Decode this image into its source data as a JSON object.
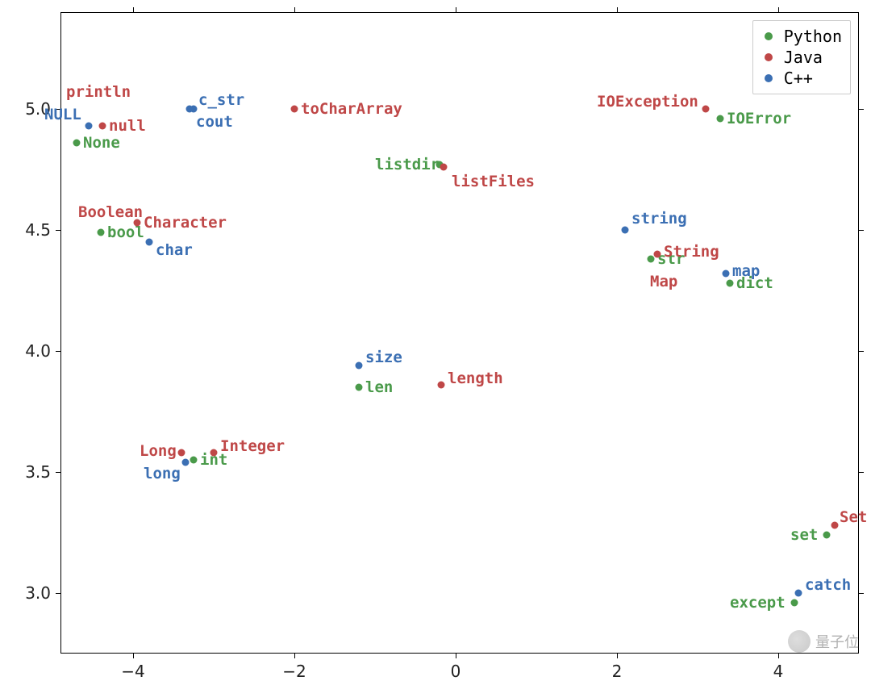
{
  "chart_data": {
    "type": "scatter",
    "xlim": [
      -4.9,
      5.0
    ],
    "ylim": [
      2.75,
      5.4
    ],
    "xticks": [
      -4,
      -2,
      0,
      2,
      4
    ],
    "yticks": [
      3.0,
      3.5,
      4.0,
      4.5,
      5.0
    ],
    "colors": {
      "Python": "#4a9a4a",
      "Java": "#bf4747",
      "C++": "#3b6fb3"
    },
    "legend": {
      "position": "upper-right",
      "entries": [
        {
          "series": "Python",
          "label": "Python"
        },
        {
          "series": "Java",
          "label": "Java"
        },
        {
          "series": "C++",
          "label": "C++"
        }
      ]
    },
    "series": [
      {
        "name": "Python",
        "points": [
          {
            "x": -4.7,
            "y": 4.86,
            "label": "None",
            "dx": 8,
            "dy": 0
          },
          {
            "x": -4.4,
            "y": 4.49,
            "label": "bool",
            "dx": 8,
            "dy": 0
          },
          {
            "x": -0.2,
            "y": 4.77,
            "label": "listdir",
            "dx": -80,
            "dy": 0,
            "anchor": "right"
          },
          {
            "x": 2.42,
            "y": 4.38,
            "label": "str",
            "dx": 8,
            "dy": 0
          },
          {
            "x": 3.4,
            "y": 4.28,
            "label": "dict",
            "dx": 8,
            "dy": 0
          },
          {
            "x": -1.2,
            "y": 3.85,
            "label": "len",
            "dx": 8,
            "dy": 0
          },
          {
            "x": -3.25,
            "y": 3.55,
            "label": "int",
            "dx": 8,
            "dy": 0
          },
          {
            "x": 4.6,
            "y": 3.24,
            "label": "set",
            "dx": -45,
            "dy": 0,
            "anchor": "right"
          },
          {
            "x": 4.2,
            "y": 2.96,
            "label": "except",
            "dx": -80,
            "dy": 0,
            "anchor": "right"
          },
          {
            "x": 3.28,
            "y": 4.96,
            "label": "IOError",
            "dx": 8,
            "dy": 0
          }
        ]
      },
      {
        "name": "Java",
        "points": [
          {
            "x": -4.05,
            "y": 5.07,
            "label": "println",
            "dx": -78,
            "dy": 0,
            "draw_point": false
          },
          {
            "x": -4.38,
            "y": 4.93,
            "label": "null",
            "dx": 8,
            "dy": 0
          },
          {
            "x": -2.0,
            "y": 5.0,
            "label": "toCharArray",
            "dx": 8,
            "dy": 0
          },
          {
            "x": -0.15,
            "y": 4.76,
            "label": "listFiles",
            "dx": 10,
            "dy": 18
          },
          {
            "x": -4.6,
            "y": 4.57,
            "label": "Boolean",
            "dx": -8,
            "dy": -1,
            "draw_point": false
          },
          {
            "x": -3.95,
            "y": 4.53,
            "label": "Character",
            "dx": 8,
            "dy": 0
          },
          {
            "x": 2.5,
            "y": 4.4,
            "label": "String",
            "dx": 8,
            "dy": -3
          },
          {
            "x": 2.85,
            "y": 4.32,
            "label": "Map",
            "dx": -44,
            "dy": 10,
            "anchor": "right",
            "draw_point": false
          },
          {
            "x": -0.18,
            "y": 3.86,
            "label": "length",
            "dx": 8,
            "dy": -8
          },
          {
            "x": -3.0,
            "y": 3.58,
            "label": "Integer",
            "dx": 8,
            "dy": -8
          },
          {
            "x": -3.4,
            "y": 3.58,
            "label": "Long",
            "dx": -52,
            "dy": -2,
            "anchor": "right"
          },
          {
            "x": 3.1,
            "y": 5.0,
            "label": "IOException",
            "dx": -135,
            "dy": -9,
            "anchor": "right"
          },
          {
            "x": 4.7,
            "y": 3.28,
            "label": "Set",
            "dx": 6,
            "dy": -10
          }
        ]
      },
      {
        "name": "C++",
        "points": [
          {
            "x": -4.55,
            "y": 4.93,
            "label": "NULL",
            "dx": -55,
            "dy": -14,
            "anchor": "right"
          },
          {
            "x": -3.25,
            "y": 5.0,
            "label": "c_str",
            "dx": 6,
            "dy": -11
          },
          {
            "x": -3.3,
            "y": 5.0,
            "label": "cout",
            "dx": 8,
            "dy": 16
          },
          {
            "x": -3.8,
            "y": 4.45,
            "label": "char",
            "dx": 8,
            "dy": 10
          },
          {
            "x": 2.1,
            "y": 4.5,
            "label": "string",
            "dx": 8,
            "dy": -14
          },
          {
            "x": 3.35,
            "y": 4.32,
            "label": "map",
            "dx": 8,
            "dy": -3
          },
          {
            "x": -1.2,
            "y": 3.94,
            "label": "size",
            "dx": 8,
            "dy": -10
          },
          {
            "x": -3.35,
            "y": 3.54,
            "label": "long",
            "dx": -52,
            "dy": 14,
            "anchor": "right"
          },
          {
            "x": 4.25,
            "y": 3.0,
            "label": "catch",
            "dx": 8,
            "dy": -10
          }
        ]
      }
    ]
  },
  "watermark": "量子位"
}
